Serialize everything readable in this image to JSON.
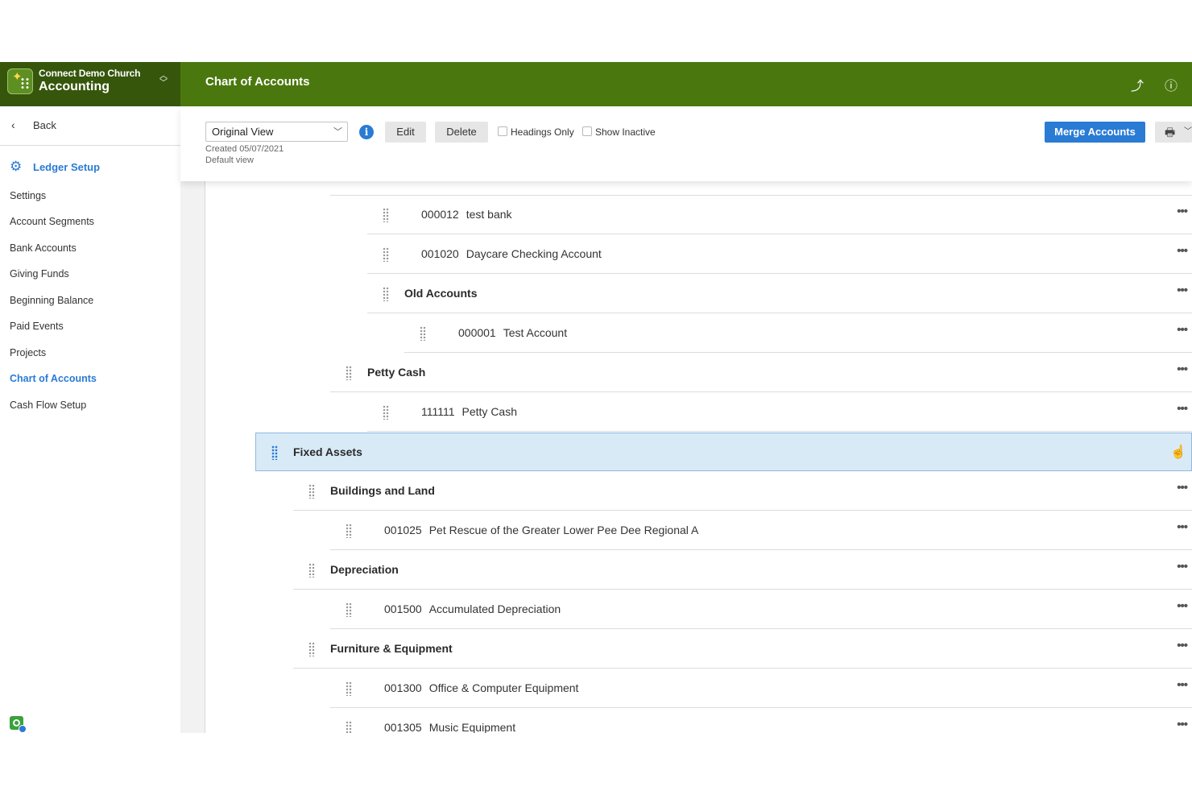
{
  "org": {
    "name": "Connect Demo Church",
    "app": "Accounting"
  },
  "header": {
    "title": "Chart of Accounts"
  },
  "sidebar": {
    "back_label": "Back",
    "section": "Ledger Setup",
    "items": [
      {
        "label": "Settings",
        "active": false
      },
      {
        "label": "Account Segments",
        "active": false
      },
      {
        "label": "Bank Accounts",
        "active": false
      },
      {
        "label": "Giving Funds",
        "active": false
      },
      {
        "label": "Beginning Balance",
        "active": false
      },
      {
        "label": "Paid Events",
        "active": false
      },
      {
        "label": "Projects",
        "active": false
      },
      {
        "label": "Chart of Accounts",
        "active": true
      },
      {
        "label": "Cash Flow Setup",
        "active": false
      }
    ]
  },
  "toolbar": {
    "view_select": "Original View",
    "created": "Created 05/07/2021",
    "default_note": "Default view",
    "edit_label": "Edit",
    "delete_label": "Delete",
    "headings_only_label": "Headings Only",
    "show_inactive_label": "Show Inactive",
    "merge_label": "Merge Accounts"
  },
  "rows": [
    {
      "number": "000012",
      "name": "test bank",
      "heading": false
    },
    {
      "number": "001020",
      "name": "Daycare Checking Account",
      "heading": false
    },
    {
      "number": "",
      "name": "Old Accounts",
      "heading": true
    },
    {
      "number": "000001",
      "name": "Test Account",
      "heading": false
    },
    {
      "number": "",
      "name": "Petty Cash",
      "heading": true
    },
    {
      "number": "111111",
      "name": "Petty Cash",
      "heading": false
    },
    {
      "number": "",
      "name": "Fixed Assets",
      "heading": true,
      "selected": true
    },
    {
      "number": "",
      "name": "Buildings and Land",
      "heading": true
    },
    {
      "number": "001025",
      "name": "Pet Rescue of the Greater Lower Pee Dee Regional A",
      "heading": false
    },
    {
      "number": "",
      "name": "Depreciation",
      "heading": true
    },
    {
      "number": "001500",
      "name": "Accumulated Depreciation",
      "heading": false
    },
    {
      "number": "",
      "name": "Furniture & Equipment",
      "heading": true
    },
    {
      "number": "001300",
      "name": "Office & Computer Equipment",
      "heading": false
    },
    {
      "number": "001305",
      "name": "Music Equipment",
      "heading": false
    }
  ],
  "colors": {
    "header_green": "#4a780e",
    "org_green": "#36560c",
    "accent_blue": "#2a7bd4",
    "selected_row": "#d9eaf7"
  },
  "icons": {
    "header": [
      "ministry-leaf-icon",
      "help-icon"
    ],
    "toolbar": [
      "info-icon",
      "printer-icon"
    ]
  }
}
